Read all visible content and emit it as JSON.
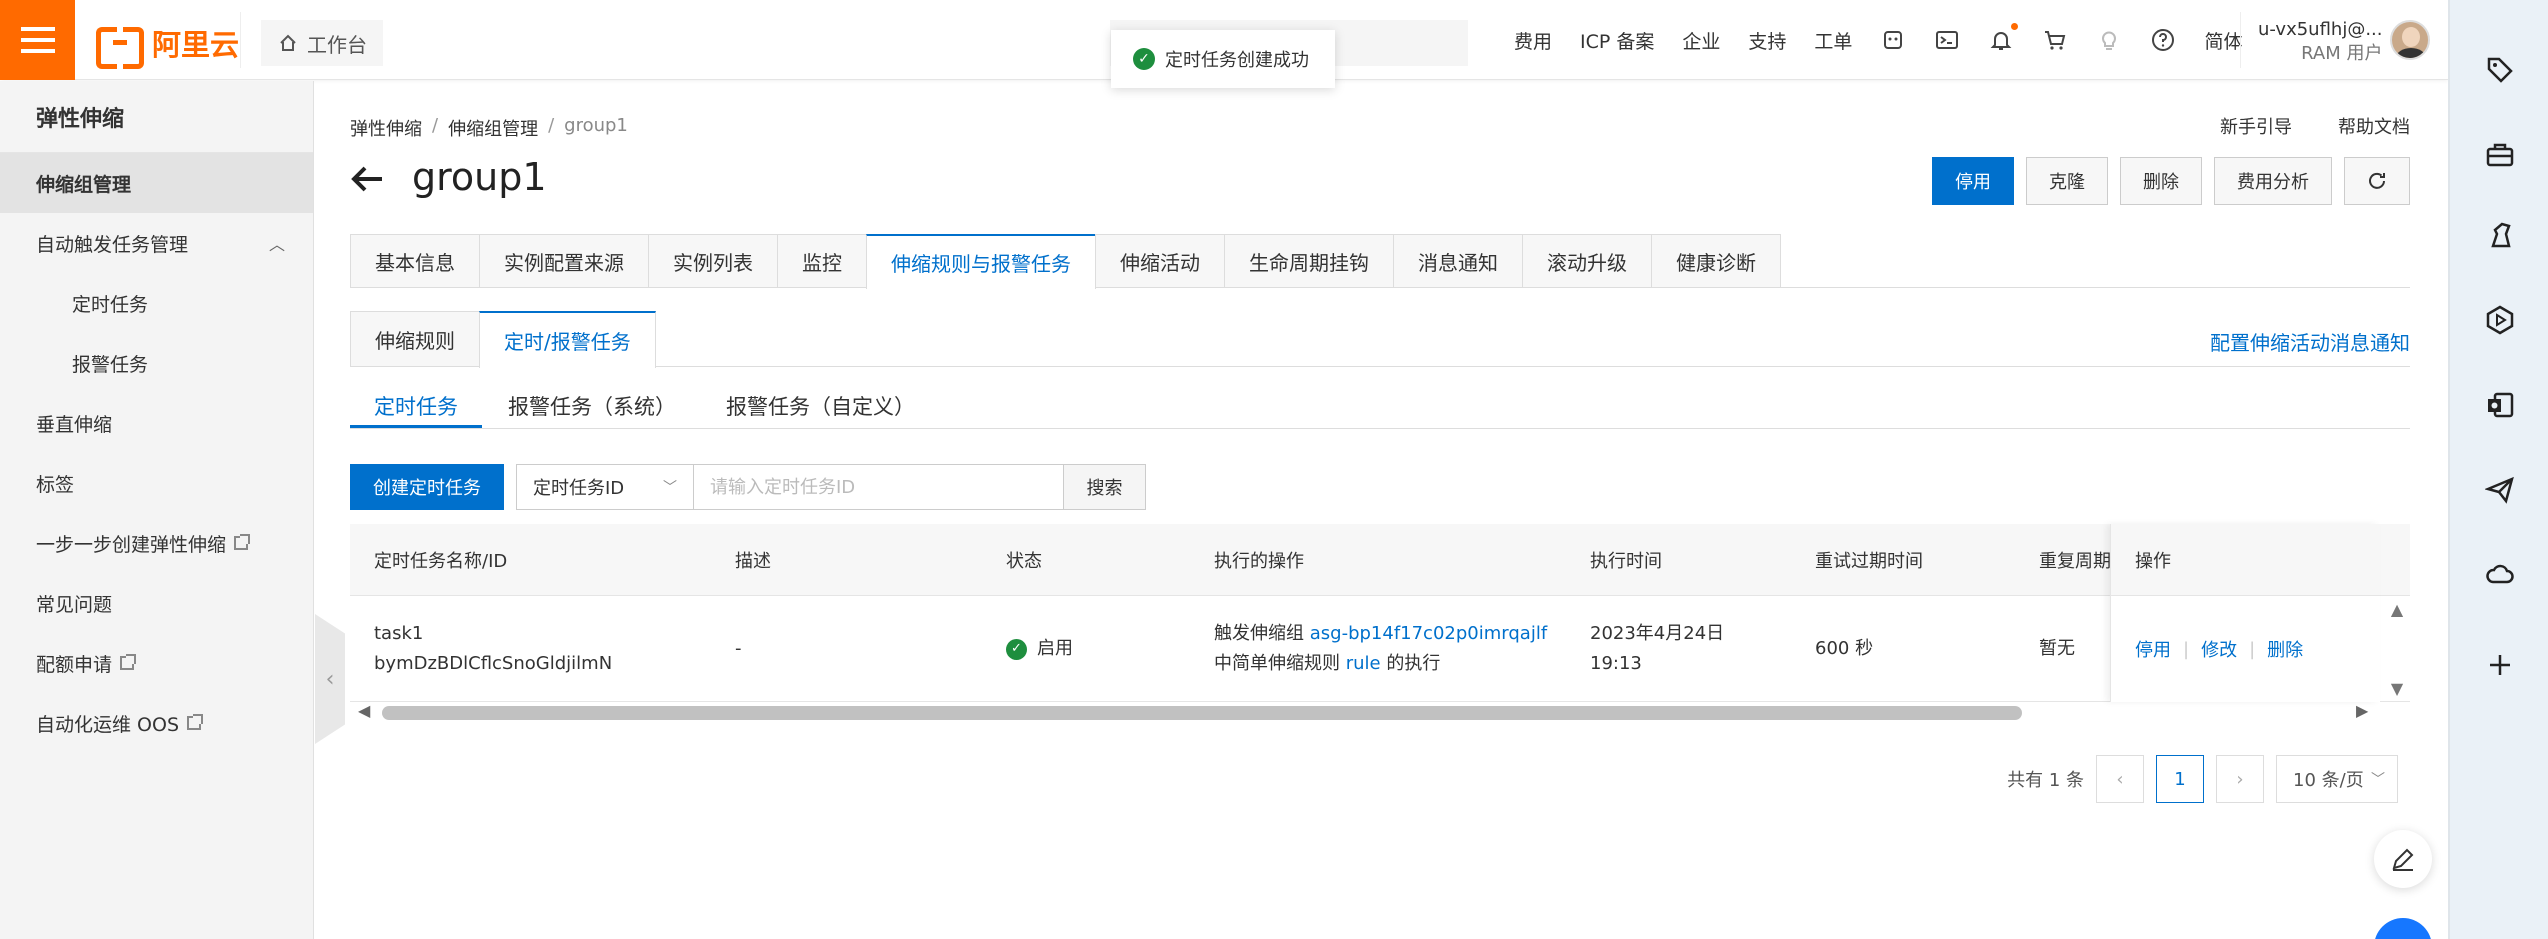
{
  "topbar": {
    "brand": "阿里云",
    "workbench": "工作台",
    "nav": [
      "费用",
      "ICP 备案",
      "企业",
      "支持",
      "工单"
    ],
    "lang": "简体",
    "user_name": "u-vx5uflhj@...",
    "user_role": "RAM 用户"
  },
  "toast": {
    "message": "定时任务创建成功"
  },
  "sidebar": {
    "title": "弹性伸缩",
    "items": [
      {
        "label": "伸缩组管理"
      },
      {
        "label": "自动触发任务管理"
      },
      {
        "label": "定时任务"
      },
      {
        "label": "报警任务"
      },
      {
        "label": "垂直伸缩"
      },
      {
        "label": "标签"
      },
      {
        "label": "一步一步创建弹性伸缩"
      },
      {
        "label": "常见问题"
      },
      {
        "label": "配额申请"
      },
      {
        "label": "自动化运维 OOS"
      }
    ]
  },
  "breadcrumb": [
    "弹性伸缩",
    "伸缩组管理",
    "group1"
  ],
  "toplinks": {
    "guide": "新手引导",
    "help": "帮助文档"
  },
  "page": {
    "title": "group1"
  },
  "actions": {
    "disable": "停用",
    "clone": "克隆",
    "delete": "删除",
    "cost": "费用分析"
  },
  "tabs": [
    "基本信息",
    "实例配置来源",
    "实例列表",
    "监控",
    "伸缩规则与报警任务",
    "伸缩活动",
    "生命周期挂钩",
    "消息通知",
    "滚动升级",
    "健康诊断"
  ],
  "subtabs": [
    "伸缩规则",
    "定时/报警任务"
  ],
  "config_link": "配置伸缩活动消息通知",
  "tasktabs": [
    "定时任务",
    "报警任务（系统）",
    "报警任务（自定义）"
  ],
  "toolbar": {
    "create": "创建定时任务",
    "select": "定时任务ID",
    "placeholder": "请输入定时任务ID",
    "search": "搜索"
  },
  "table": {
    "headers": [
      "定时任务名称/ID",
      "描述",
      "状态",
      "执行的操作",
      "执行时间",
      "重试过期时间",
      "重复周期",
      "操作"
    ],
    "rows": [
      {
        "name": "task1",
        "id": "bymDzBDlCflcSnoGldjilmN",
        "desc": "-",
        "status": "启用",
        "op_pre": "触发伸缩组",
        "op_group": "asg-bp14f17c02p0imrqajlf",
        "op_mid": "中简单伸缩规则",
        "op_rule": "rule",
        "op_post": "的执行",
        "time_date": "2023年4月24日",
        "time_clock": "19:13",
        "retry": "600 秒",
        "repeat": "暂无",
        "ops": [
          "停用",
          "修改",
          "删除"
        ]
      }
    ]
  },
  "pager": {
    "total": "共有 1 条",
    "page": "1",
    "size": "10 条/页"
  },
  "colors": {
    "brand": "#ff6a00",
    "primary": "#0070cc",
    "success": "#1e8e3e"
  }
}
